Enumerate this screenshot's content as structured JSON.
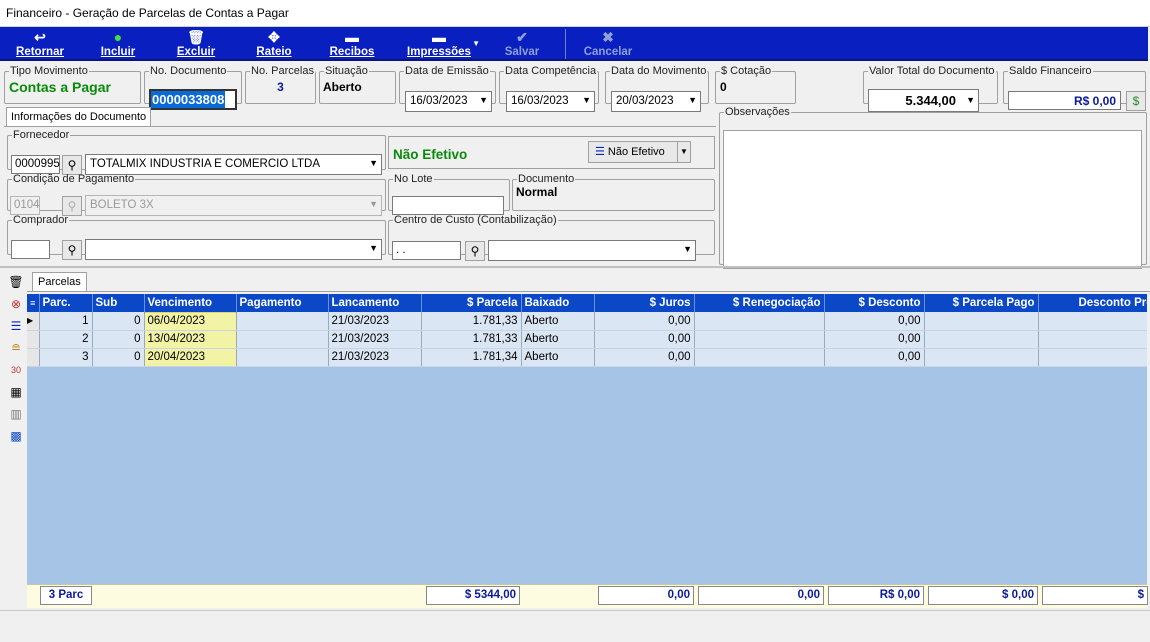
{
  "window": {
    "title": "Financeiro - Geração de Parcelas de Contas a Pagar"
  },
  "toolbar": {
    "retornar": "Retornar",
    "incluir": "Incluir",
    "excluir": "Excluir",
    "rateio": "Rateio",
    "recibos": "Recibos",
    "impressoes": "Impressões",
    "salvar": "Salvar",
    "cancelar": "Cancelar"
  },
  "header": {
    "tipo_movimento": {
      "label": "Tipo Movimento",
      "value": "Contas a Pagar"
    },
    "no_documento": {
      "label": "No. Documento",
      "value": "0000033808"
    },
    "no_parcelas": {
      "label": "No. Parcelas",
      "value": "3"
    },
    "situacao": {
      "label": "Situação",
      "value": "Aberto"
    },
    "data_emissao": {
      "label": "Data de Emissão",
      "value": "16/03/2023"
    },
    "data_competencia": {
      "label": "Data Competência",
      "value": "16/03/2023"
    },
    "data_movimento": {
      "label": "Data do Movimento",
      "value": "20/03/2023"
    },
    "cotacao": {
      "label": "$ Cotação",
      "value": "0"
    },
    "valor_total": {
      "label": "Valor Total do Documento",
      "value": "5.344,00"
    },
    "saldo_financeiro": {
      "label": "Saldo Financeiro",
      "value": "R$ 0,00"
    }
  },
  "info_tab": {
    "label": "Informações do Documento"
  },
  "form": {
    "fornecedor": {
      "label": "Fornecedor",
      "code": "0000995",
      "name": "TOTALMIX INDUSTRIA E COMERCIO LTDA"
    },
    "status": {
      "value": "Não Efetivo",
      "button": "Não Efetivo"
    },
    "condicao": {
      "label": "Condição de Pagamento",
      "code": "0104",
      "name": "BOLETO 3X"
    },
    "no_lote": {
      "label": "No Lote",
      "value": ""
    },
    "documento": {
      "label": "Documento",
      "value": "Normal"
    },
    "comprador": {
      "label": "Comprador",
      "code": "",
      "name": ""
    },
    "centro_custo": {
      "label": "Centro de Custo (Contabilização)",
      "code": " .  .",
      "name": ""
    },
    "observacoes": {
      "label": "Observações",
      "value": ""
    }
  },
  "parcelas_tab": {
    "label": "Parcelas"
  },
  "grid": {
    "columns": [
      "Parc.",
      "Sub",
      "Vencimento",
      "Pagamento",
      "Lancamento",
      "$ Parcela",
      "Baixado",
      "$ Juros",
      "$ Renegociação",
      "$ Desconto",
      "$ Parcela Pago",
      "Desconto Pré-F"
    ],
    "rows": [
      [
        "1",
        "0",
        "06/04/2023",
        "",
        "21/03/2023",
        "1.781,33",
        "Aberto",
        "0,00",
        "",
        "0,00",
        "",
        ""
      ],
      [
        "2",
        "0",
        "13/04/2023",
        "",
        "21/03/2023",
        "1.781,33",
        "Aberto",
        "0,00",
        "",
        "0,00",
        "",
        ""
      ],
      [
        "3",
        "0",
        "20/04/2023",
        "",
        "21/03/2023",
        "1.781,34",
        "Aberto",
        "0,00",
        "",
        "0,00",
        "",
        ""
      ]
    ]
  },
  "footer": {
    "count": "3 Parc",
    "parcela": "$ 5344,00",
    "juros": "0,00",
    "renegociacao": "0,00",
    "desconto": "R$ 0,00",
    "parcela_pago": "$ 0,00",
    "desconto_pre": "$"
  },
  "colors": {
    "toolbar": "#0a1fbf",
    "grid_header": "#0a48c8",
    "grid_body": "#a6c4e6",
    "green": "#0a8a0a",
    "highlight": "#f3f3a6"
  }
}
